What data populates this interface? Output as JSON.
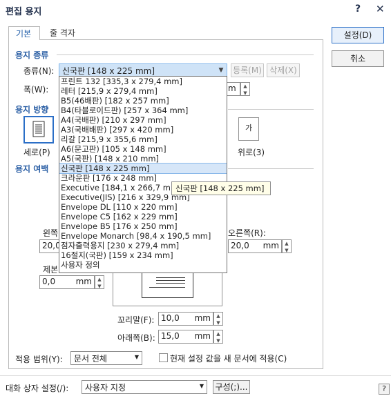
{
  "window": {
    "title": "편집 용지",
    "help": "?",
    "close": "✕"
  },
  "tabs": [
    {
      "label": "기본"
    },
    {
      "label": "줄 격자"
    }
  ],
  "buttons": {
    "ok": "설정(D)",
    "cancel": "취소"
  },
  "paper_type": {
    "section": "용지 종류",
    "kind_label": "종류(N):",
    "kind_value": "신국판 [148 x 225 mm]",
    "register": "등록(M)",
    "delete": "삭제(X)",
    "width_label": "폭(W):",
    "width_unit_fragment": "m"
  },
  "orientation": {
    "section": "용지 방향",
    "portrait": "세로(P)",
    "landscape": "위로(3)",
    "landscape_glyph": "가"
  },
  "margins": {
    "section": "용지 여백",
    "left_label_fragment": "왼쪽",
    "left_value_fragment": "20,0",
    "right_label": "오른쪽(R):",
    "right_value": "20,0",
    "right_unit": "mm",
    "binding_label_fragment": "제본",
    "binding_value": "0,0",
    "binding_unit": "mm",
    "footer_label": "꼬리말(F):",
    "footer_value": "10,0",
    "footer_unit": "mm",
    "bottom_label": "아래쪽(B):",
    "bottom_value": "15,0",
    "bottom_unit": "mm"
  },
  "dropdown": {
    "items": [
      "프린트 132 [335,3 x 279,4 mm]",
      "레터 [215,9 x 279,4 mm]",
      "B5(46배판) [182 x 257 mm]",
      "B4(타블로이드판) [257 x 364 mm]",
      "A4(국배판) [210 x 297 mm]",
      "A3(국배배판) [297 x 420 mm]",
      "리갈 [215,9 x 355,6 mm]",
      "A6(문고판) [105 x 148 mm]",
      "A5(국판) [148 x 210 mm]",
      "신국판 [148 x 225 mm]",
      "크라운판 [176 x 248 mm]",
      "Executive [184,1 x 266,7 mm]",
      "Executive(JIS) [216 x 329,9 mm]",
      "Envelope DL [110 x 220 mm]",
      "Envelope C5 [162 x 229 mm]",
      "Envelope B5 [176 x 250 mm]",
      "Envelope Monarch [98,4 x 190,5 mm]",
      "점자출력용지 [230 x 279,4 mm]",
      "16절지(국판) [159 x 234 mm]",
      "사용자 정의"
    ],
    "selected_index": 9,
    "tooltip": "신국판 [148 x 225 mm]"
  },
  "apply": {
    "scope_label": "적용 범위(Y):",
    "scope_value": "문서 전체",
    "new_doc_label": "현재 설정 값을 새 문서에 적용(C)"
  },
  "footer": {
    "dialog_setting_label": "대화 상자 설정(/):",
    "dialog_setting_value": "사용자 지정",
    "config_button": "구성(;)...",
    "help": "?"
  },
  "colors": {
    "accent": "#2b6fc7",
    "section": "#2b5fa5",
    "selection": "#cfe3f7"
  }
}
